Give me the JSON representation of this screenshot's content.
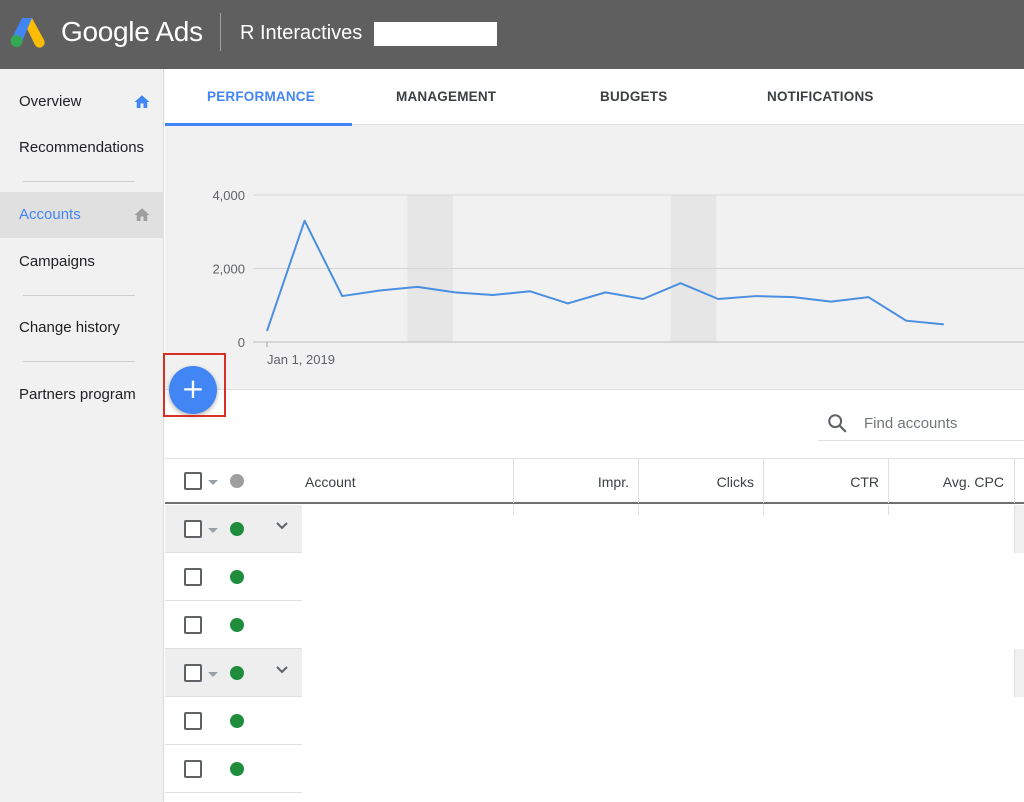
{
  "header": {
    "brand": "Google Ads",
    "account_name": "R Interactives"
  },
  "sidebar": {
    "items": [
      {
        "label": "Overview",
        "icon": "home-icon"
      },
      {
        "label": "Recommendations"
      },
      {
        "label": "Accounts",
        "icon": "home-icon",
        "active": true
      },
      {
        "label": "Campaigns"
      },
      {
        "label": "Change history"
      },
      {
        "label": "Partners program"
      }
    ]
  },
  "tabs": [
    {
      "label": "PERFORMANCE",
      "active": true
    },
    {
      "label": "MANAGEMENT"
    },
    {
      "label": "BUDGETS"
    },
    {
      "label": "NOTIFICATIONS"
    }
  ],
  "chart_data": {
    "type": "line",
    "title": "",
    "xlabel": "",
    "ylabel": "",
    "ylim": [
      0,
      4000
    ],
    "y_ticks": [
      "4,000",
      "2,000",
      "0"
    ],
    "x_tick_label": "Jan 1, 2019",
    "grid": true,
    "series": [
      {
        "color": "#4a8fe0",
        "values": [
          300,
          3300,
          1250,
          1400,
          1500,
          1350,
          1280,
          1380,
          1050,
          1350,
          1170,
          1600,
          1170,
          1250,
          1220,
          1100,
          1220,
          580,
          480
        ]
      }
    ],
    "weekend_bands": [
      [
        4,
        5
      ],
      [
        11,
        12
      ]
    ]
  },
  "fab": {
    "label": "+",
    "icon": "plus-icon"
  },
  "search": {
    "placeholder": "Find accounts",
    "icon": "search-icon"
  },
  "table": {
    "columns": [
      "Account",
      "Impr.",
      "Clicks",
      "CTR",
      "Avg. CPC"
    ],
    "rows": [
      {
        "type": "group",
        "status": "enabled"
      },
      {
        "type": "account",
        "status": "enabled"
      },
      {
        "type": "account",
        "status": "enabled"
      },
      {
        "type": "group",
        "status": "enabled"
      },
      {
        "type": "account",
        "status": "enabled"
      },
      {
        "type": "account",
        "status": "enabled"
      }
    ]
  },
  "colors": {
    "accent": "#4285f4",
    "topbar": "#5f5f5f",
    "status_enabled": "#1e8e3e",
    "highlight": "#d93025"
  }
}
